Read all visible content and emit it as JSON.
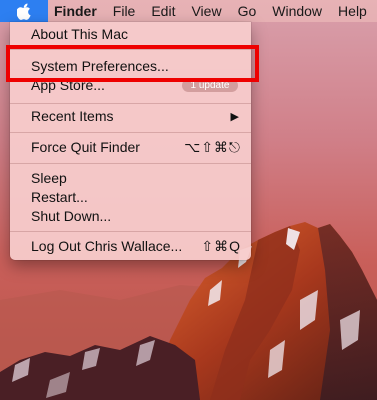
{
  "menubar": {
    "apple_icon": "apple-logo-icon",
    "items": [
      "Finder",
      "File",
      "Edit",
      "View",
      "Go",
      "Window",
      "Help"
    ]
  },
  "apple_menu": {
    "about": "About This Mac",
    "system_prefs": "System Preferences...",
    "app_store": "App Store...",
    "app_store_badge": "1 update",
    "recent_items": "Recent Items",
    "force_quit": "Force Quit Finder",
    "force_quit_shortcut": "⌥⇧⌘⎋",
    "sleep": "Sleep",
    "restart": "Restart...",
    "shut_down": "Shut Down...",
    "log_out": "Log Out Chris Wallace...",
    "log_out_shortcut": "⇧⌘Q"
  },
  "colors": {
    "highlight": "#ee0000",
    "apple_tab": "#2d7ff1"
  }
}
